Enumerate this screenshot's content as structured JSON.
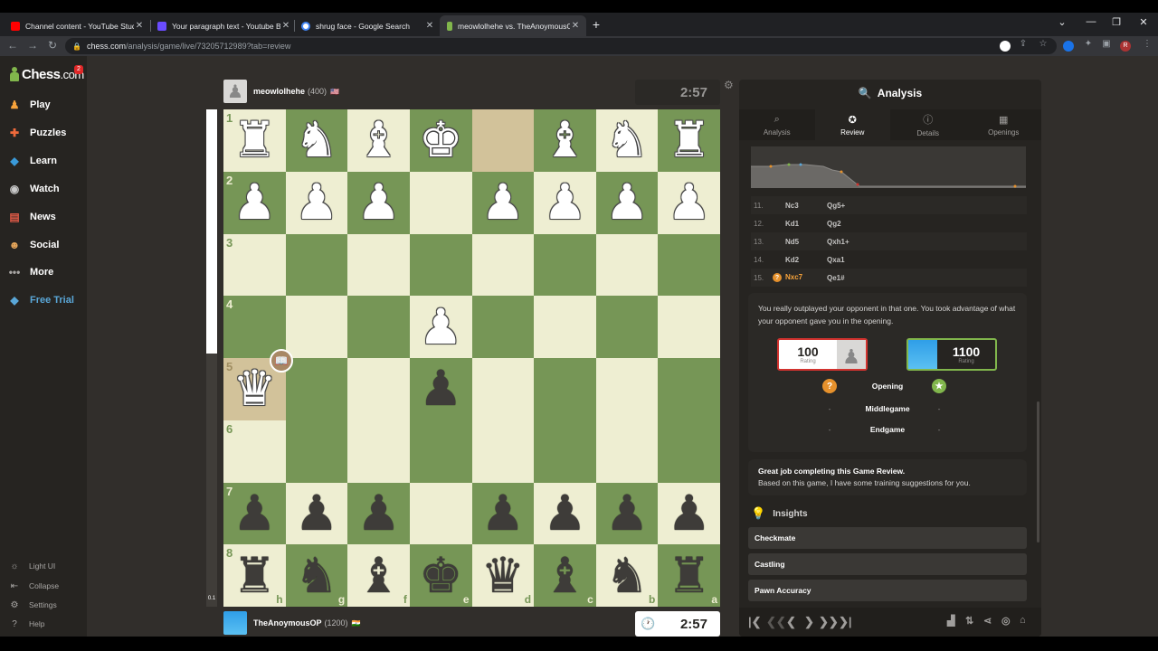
{
  "browser": {
    "tabs": [
      {
        "title": "Channel content - YouTube Studio",
        "close": "✕",
        "color": "#ff0000"
      },
      {
        "title": "Your paragraph text - Youtube Banner",
        "close": "✕",
        "color": "#6a4cff"
      },
      {
        "title": "shrug face - Google Search",
        "close": "✕",
        "color": "#4285f4"
      },
      {
        "title": "meowlolhehe vs. TheAnoymousOP",
        "close": "✕",
        "color": "#81b64c"
      }
    ],
    "new_tab": "+",
    "url_host": "chess.com",
    "url_path": "/analysis/game/live/73205712989?tab=review",
    "window_controls": [
      "⌄",
      "—",
      "❐",
      "✕"
    ],
    "profile_initial": "R"
  },
  "sidebar": {
    "logo_main": "Chess",
    "logo_suffix": ".com",
    "notification_count": "2",
    "items": [
      {
        "label": "Play",
        "icon": "play-icon",
        "color": "#f7a33b"
      },
      {
        "label": "Puzzles",
        "icon": "puzzle-icon",
        "color": "#ef6a3b"
      },
      {
        "label": "Learn",
        "icon": "learn-icon",
        "color": "#3a9ad9"
      },
      {
        "label": "Watch",
        "icon": "binoculars-icon",
        "color": "#c9c9c9"
      },
      {
        "label": "News",
        "icon": "news-icon",
        "color": "#e05a47"
      },
      {
        "label": "Social",
        "icon": "social-icon",
        "color": "#e8a75b"
      },
      {
        "label": "More",
        "icon": "more-icon",
        "color": "#a8a6a4"
      },
      {
        "label": "Free Trial",
        "icon": "diamond-icon",
        "color": "#5aa7d8"
      }
    ],
    "bottom": [
      {
        "label": "Light UI",
        "icon": "sun-icon"
      },
      {
        "label": "Collapse",
        "icon": "collapse-icon"
      },
      {
        "label": "Settings",
        "icon": "gear-icon"
      },
      {
        "label": "Help",
        "icon": "help-icon"
      }
    ]
  },
  "game": {
    "top_player": {
      "name": "meowlolhehe",
      "rating": "(400)",
      "flag": "🇺🇸"
    },
    "bottom_player": {
      "name": "TheAnoymousOP",
      "rating": "(1200)",
      "flag": "🇮🇳"
    },
    "top_clock": "2:57",
    "bottom_clock": "2:57",
    "eval_score": "0.1",
    "eval_white_fraction": 0.49,
    "ranks": [
      "1",
      "2",
      "3",
      "4",
      "5",
      "6",
      "7",
      "8"
    ],
    "files": [
      "h",
      "g",
      "f",
      "e",
      "d",
      "c",
      "b",
      "a"
    ]
  },
  "panel": {
    "title": "Analysis",
    "tabs": [
      {
        "label": "Analysis",
        "icon": "magnifier-icon"
      },
      {
        "label": "Review",
        "icon": "star-icon"
      },
      {
        "label": "Details",
        "icon": "info-icon"
      },
      {
        "label": "Openings",
        "icon": "book-icon"
      }
    ],
    "moves": [
      {
        "num": "11.",
        "white": "Nc3",
        "black": "Qg5+"
      },
      {
        "num": "12.",
        "white": "Kd1",
        "black": "Qg2"
      },
      {
        "num": "13.",
        "white": "Nd5",
        "black": "Qxh1+"
      },
      {
        "num": "14.",
        "white": "Kd2",
        "black": "Qxa1"
      },
      {
        "num": "15.",
        "white": "Nxc7",
        "black": "Qe1#",
        "mark": "?"
      }
    ],
    "summary": "You really outplayed your opponent in that one. You took advantage of what your opponent gave you in the opening.",
    "left_rating": "100",
    "right_rating": "1100",
    "rating_label": "Rating",
    "phases": [
      {
        "name": "Opening",
        "left": "?",
        "right": "★"
      },
      {
        "name": "Middlegame",
        "left": "-",
        "right": "-"
      },
      {
        "name": "Endgame",
        "left": "-",
        "right": "-"
      }
    ],
    "great_job_title": "Great job completing this Game Review.",
    "great_job_text": "Based on this game, I have some training suggestions for you.",
    "insights_title": "Insights",
    "insights": [
      "Checkmate",
      "Castling",
      "Pawn Accuracy"
    ],
    "controls": [
      "|❮",
      "❮❮",
      "❮",
      "❯",
      "❯❯",
      "❯|"
    ]
  }
}
